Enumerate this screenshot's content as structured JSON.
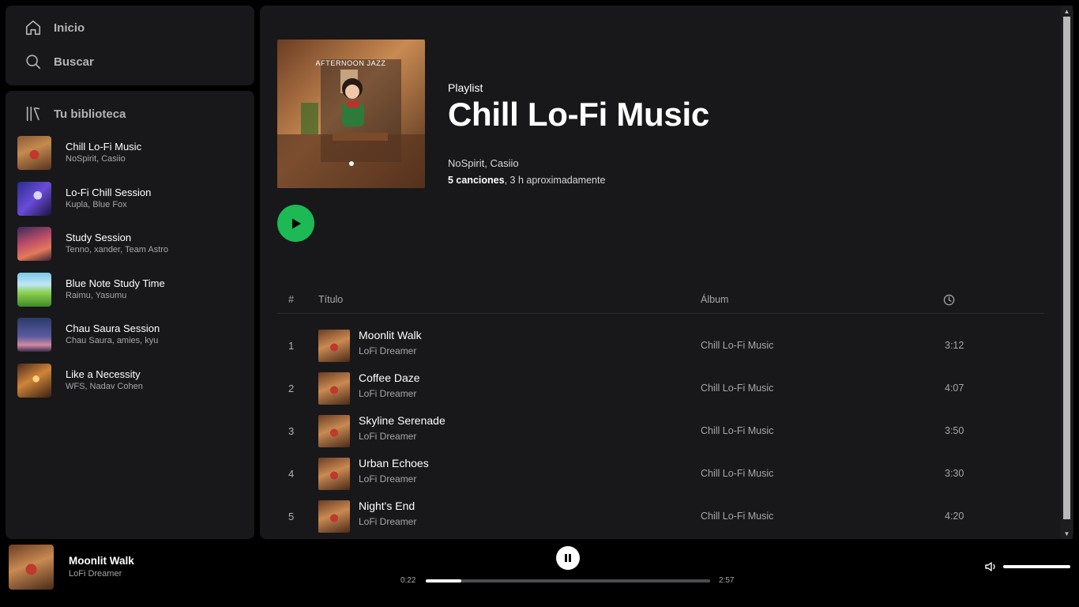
{
  "nav": {
    "home_label": "Inicio",
    "search_label": "Buscar"
  },
  "library": {
    "title": "Tu biblioteca",
    "items": [
      {
        "title": "Chill Lo-Fi Music",
        "subtitle": "NoSpirit, Casiio"
      },
      {
        "title": "Lo-Fi Chill Session",
        "subtitle": "Kupla, Blue Fox"
      },
      {
        "title": "Study Session",
        "subtitle": "Tenno, xander, Team Astro"
      },
      {
        "title": "Blue Note Study Time",
        "subtitle": "Raimu, Yasumu"
      },
      {
        "title": "Chau Saura Session",
        "subtitle": "Chau Saura, amies, kyu"
      },
      {
        "title": "Like a Necessity",
        "subtitle": "WFS, Nadav Cohen"
      }
    ]
  },
  "playlist": {
    "type": "Playlist",
    "title": "Chill Lo-Fi Music",
    "artists": "NoSpirit, Casiio",
    "count_bold": "5 canciones",
    "count_rest": ", 3 h aproximadamente",
    "cover_text": "AFTERNOON JAZZ"
  },
  "table": {
    "col_num": "#",
    "col_title": "Título",
    "col_album": "Álbum",
    "rows": [
      {
        "num": "1",
        "title": "Moonlit Walk",
        "artist": "LoFi Dreamer",
        "album": "Chill Lo-Fi Music",
        "duration": "3:12"
      },
      {
        "num": "2",
        "title": "Coffee Daze",
        "artist": "LoFi Dreamer",
        "album": "Chill Lo-Fi Music",
        "duration": "4:07"
      },
      {
        "num": "3",
        "title": "Skyline Serenade",
        "artist": "LoFi Dreamer",
        "album": "Chill Lo-Fi Music",
        "duration": "3:50"
      },
      {
        "num": "4",
        "title": "Urban Echoes",
        "artist": "LoFi Dreamer",
        "album": "Chill Lo-Fi Music",
        "duration": "3:30"
      },
      {
        "num": "5",
        "title": "Night's End",
        "artist": "LoFi Dreamer",
        "album": "Chill Lo-Fi Music",
        "duration": "4:20"
      }
    ]
  },
  "player": {
    "title": "Moonlit Walk",
    "artist": "LoFi Dreamer",
    "current_time": "0:22",
    "total_time": "2:57",
    "progress_fraction": 0.124,
    "volume_fraction": 1.0
  },
  "colors": {
    "accent": "#1db954",
    "panel": "#18181b",
    "background": "#000000"
  },
  "icons": {
    "home": "home-icon",
    "search": "search-icon",
    "library": "library-icon",
    "play": "play-icon",
    "pause": "pause-icon",
    "clock": "clock-icon",
    "volume": "volume-icon"
  }
}
